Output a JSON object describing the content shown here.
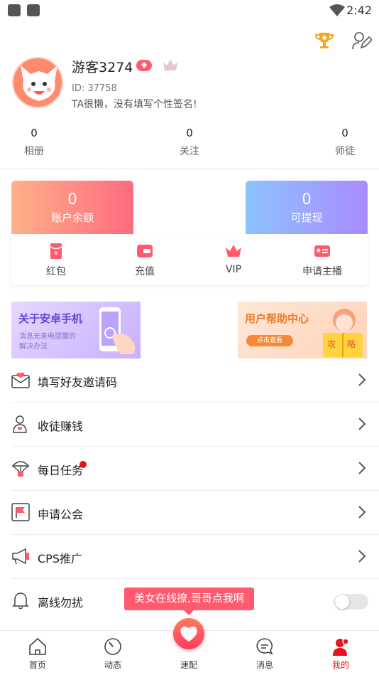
{
  "status_bar": {
    "time": "2:42"
  },
  "profile": {
    "nickname": "游客3274",
    "user_id": "ID: 37758",
    "signature": "TA很懒，没有填写个性签名!"
  },
  "stats": [
    {
      "value": "0",
      "label": "相册"
    },
    {
      "value": "0",
      "label": "关注"
    },
    {
      "value": "0",
      "label": "师徒"
    }
  ],
  "wallet": {
    "balance_value": "0",
    "balance_label": "账户余额",
    "withdraw_value": "0",
    "withdraw_label": "可提现",
    "actions": [
      {
        "label": "红包",
        "icon": "red-envelope-icon"
      },
      {
        "label": "充值",
        "icon": "wallet-icon"
      },
      {
        "label": "VIP",
        "icon": "crown-icon"
      },
      {
        "label": "申请主播",
        "icon": "id-card-icon"
      }
    ]
  },
  "banners": {
    "android": {
      "title": "关于安卓手机",
      "sub1": "消息无来电提醒的",
      "sub2": "解决办法"
    },
    "help": {
      "title": "用户帮助中心",
      "button": "点击查看",
      "book1": "攻",
      "book2": "略"
    }
  },
  "menu": [
    {
      "label": "填写好友邀请码",
      "icon": "envelope-heart-icon"
    },
    {
      "label": "收徒赚钱",
      "icon": "person-heart-icon"
    },
    {
      "label": "每日任务",
      "icon": "parachute-icon"
    },
    {
      "label": "申请公会",
      "icon": "flag-icon"
    },
    {
      "label": "CPS推广",
      "icon": "megaphone-icon"
    },
    {
      "label": "离线勿扰",
      "icon": "bell-icon"
    }
  ],
  "tooltip": "美女在线撩,哥哥点我啊",
  "tabs": [
    {
      "label": "首页",
      "icon": "home-icon"
    },
    {
      "label": "动态",
      "icon": "compass-icon"
    },
    {
      "label": "速配",
      "icon": "heart-icon"
    },
    {
      "label": "消息",
      "icon": "chat-icon"
    },
    {
      "label": "我的",
      "icon": "profile-icon"
    }
  ],
  "colors": {
    "accent": "#ff5a6e",
    "active_tab": "#e8121e"
  }
}
